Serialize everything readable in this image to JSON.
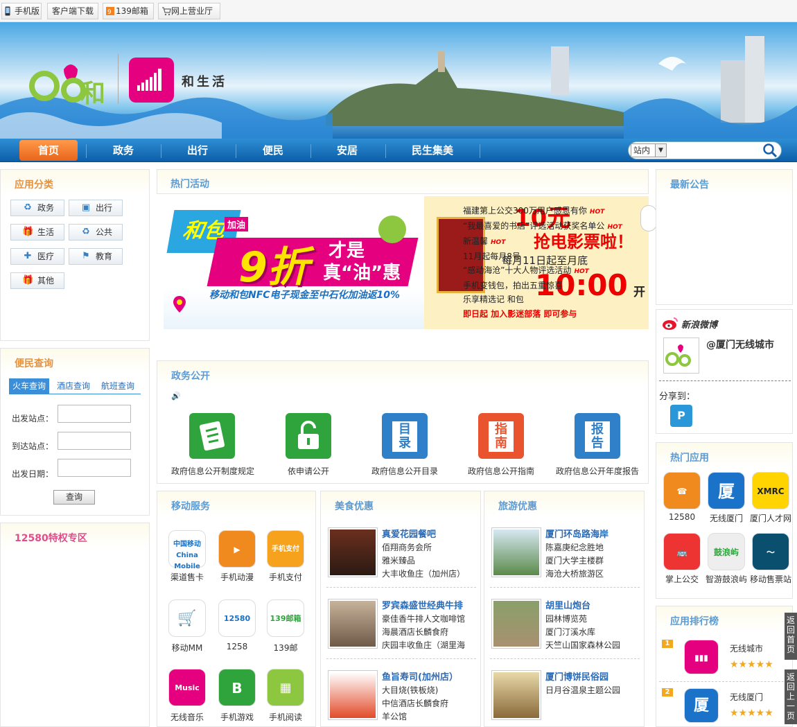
{
  "topbar": {
    "mobile": "手机版",
    "client": "客户端下载",
    "mail": "139邮箱",
    "hall": "网上营业厅"
  },
  "brand": {
    "and_logo": "and",
    "he_char": "和",
    "he_life": "和生活"
  },
  "nav": {
    "items": [
      "首页",
      "政务",
      "出行",
      "便民",
      "安居",
      "民生集美"
    ],
    "search_select": "站内"
  },
  "app_category": {
    "title": "应用分类",
    "buttons": [
      "政务",
      "出行",
      "生活",
      "公共",
      "医疗",
      "教育",
      "其他"
    ]
  },
  "convenience": {
    "title": "便民查询",
    "tabs": [
      "火车查询",
      "酒店查询",
      "航班查询"
    ],
    "depart_label": "出发站点：",
    "arrive_label": "到达站点：",
    "date_label": "出发日期：",
    "query_button": "查询"
  },
  "privilege": {
    "title": "12580特权专区"
  },
  "hot_activity": {
    "title": "热门活动",
    "banner1": {
      "brand": "和包",
      "tag": "加油",
      "big": "9折",
      "suffix1": "才是",
      "suffix2": "真“油”惠",
      "sub": "移动和包NFC电子现金至中石化加油返10%"
    },
    "banner2": {
      "price": "10元",
      "headline": "抢电影票啦！",
      "date": "每月11日起至月底",
      "time": "10:00",
      "time_suffix": "开",
      "footer": "即日起",
      "footer2": "加入影迷部落 即可参与"
    },
    "list": [
      "福建第上公交300万用户感恩有你",
      "“我最喜爱的书店”评选活动获奖名单公",
      "新温馨",
      "11月起每月8号",
      "“感动海沧”十大人物评选活动",
      "手机变钱包，拍出五重惊喜",
      "乐享精选记",
      "和包"
    ],
    "hot_label": "HOT"
  },
  "gov": {
    "title": "政务公开",
    "items": [
      {
        "label": "政府信息公开制度规定",
        "icon": "rule-icon",
        "glyph": "≡"
      },
      {
        "label": "依申请公开",
        "icon": "unlock-icon",
        "glyph": "🔓"
      },
      {
        "label": "政府信息公开目录",
        "icon": "catalog-icon",
        "glyph": "目录"
      },
      {
        "label": "政府信息公开指南",
        "icon": "guide-icon",
        "glyph": "指南"
      },
      {
        "label": "政府信息公开年度报告",
        "icon": "report-icon",
        "glyph": "报告"
      }
    ]
  },
  "mobile_service": {
    "title": "移动服务",
    "apps": [
      "渠道售卡",
      "手机动漫",
      "手机支付",
      "移动MM",
      "1258",
      "139邮",
      "无线音乐",
      "手机游戏",
      "手机阅读"
    ]
  },
  "food": {
    "title": "美食优惠",
    "items": [
      {
        "name": "真爱花园餐吧",
        "lines": [
          "佰翔商务会所",
          "雅米臻品",
          "大丰收鱼庄（加州店）"
        ]
      },
      {
        "name": "罗宾森盛世经典牛排",
        "lines": [
          "豪佳香牛排人文咖啡馆",
          "海晨酒店长麟食府",
          "庆园丰收鱼庄（湖里海"
        ]
      },
      {
        "name": "鱼旨寿司(加州店）",
        "lines": [
          "大目烧(铁板烧)",
          "中信酒店长麟食府",
          "羊公馆"
        ]
      }
    ]
  },
  "travel": {
    "title": "旅游优惠",
    "items": [
      {
        "name": "厦门环岛路海岸",
        "lines": [
          "陈嘉庚纪念胜地",
          "厦门大学主楼群",
          "海沧大桥旅游区"
        ]
      },
      {
        "name": "胡里山炮台",
        "lines": [
          "园林博览苑",
          "厦门汀溪水库",
          "天竺山国家森林公园"
        ]
      },
      {
        "name": "厦门博饼民俗园",
        "lines": [
          "日月谷温泉主题公园"
        ]
      }
    ]
  },
  "notice": {
    "title": "最新公告"
  },
  "weibo": {
    "title": "新浪微博",
    "account": "@厦门无线城市",
    "share": "分享到："
  },
  "hot_apps": {
    "title": "热门应用",
    "apps": [
      "12580",
      "无线厦门",
      "厦门人才网",
      "掌上公交",
      "智游鼓浪屿",
      "移动售票站"
    ]
  },
  "ranking": {
    "title": "应用排行榜",
    "items": [
      {
        "rank": "1",
        "name": "无线城市",
        "stars": "★★★★★"
      },
      {
        "rank": "2",
        "name": "无线厦门",
        "stars": "★★★★★"
      }
    ]
  },
  "side_tabs": {
    "home": "返回首页",
    "prev": "返回上一页"
  }
}
